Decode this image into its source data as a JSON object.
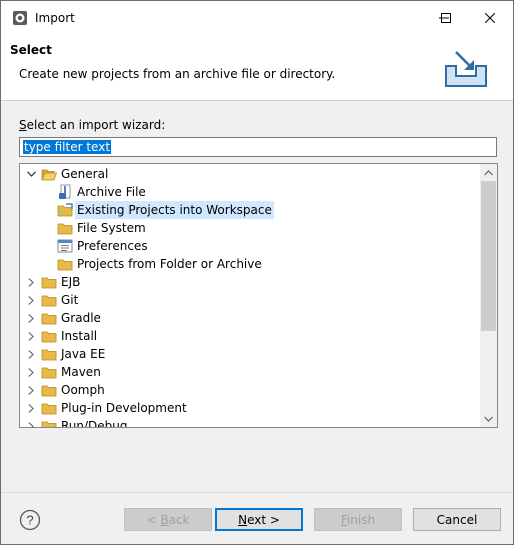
{
  "window": {
    "title": "Import",
    "icon": "eclipse-import-icon",
    "controls": [
      "minimize-icon",
      "maximize-icon",
      "close-icon"
    ]
  },
  "header": {
    "title": "Select",
    "description": "Create new projects from an archive file or directory.",
    "banner_icon": "import-wizard-banner-icon"
  },
  "wizard_label": {
    "mnemonic": "S",
    "rest": "elect an import wizard:"
  },
  "filter": {
    "value": "type filter text",
    "selected": true
  },
  "tree": {
    "items": [
      {
        "label": "General",
        "level": 0,
        "expanded": true,
        "icon": "folder-open-icon"
      },
      {
        "label": "Archive File",
        "level": 1,
        "icon": "archive-file-icon"
      },
      {
        "label": "Existing Projects into Workspace",
        "level": 1,
        "icon": "existing-projects-icon",
        "selected": true
      },
      {
        "label": "File System",
        "level": 1,
        "icon": "folder-icon"
      },
      {
        "label": "Preferences",
        "level": 1,
        "icon": "preferences-icon"
      },
      {
        "label": "Projects from Folder or Archive",
        "level": 1,
        "icon": "folder-icon"
      },
      {
        "label": "EJB",
        "level": 0,
        "expanded": false,
        "icon": "folder-icon"
      },
      {
        "label": "Git",
        "level": 0,
        "expanded": false,
        "icon": "folder-icon"
      },
      {
        "label": "Gradle",
        "level": 0,
        "expanded": false,
        "icon": "folder-icon"
      },
      {
        "label": "Install",
        "level": 0,
        "expanded": false,
        "icon": "folder-icon"
      },
      {
        "label": "Java EE",
        "level": 0,
        "expanded": false,
        "icon": "folder-icon"
      },
      {
        "label": "Maven",
        "level": 0,
        "expanded": false,
        "icon": "folder-icon"
      },
      {
        "label": "Oomph",
        "level": 0,
        "expanded": false,
        "icon": "folder-icon"
      },
      {
        "label": "Plug-in Development",
        "level": 0,
        "expanded": false,
        "icon": "folder-icon"
      },
      {
        "label": "Run/Debug",
        "level": 0,
        "expanded": false,
        "icon": "folder-icon"
      }
    ]
  },
  "buttons": {
    "back": "< Back",
    "back_mnemonic": "B",
    "next": "Next >",
    "next_mnemonic": "N",
    "finish": "Finish",
    "finish_mnemonic": "F",
    "cancel": "Cancel"
  },
  "colors": {
    "selection_bg": "#cde8ff",
    "filter_highlight": "#0078d7",
    "folder": "#e8b84a"
  }
}
